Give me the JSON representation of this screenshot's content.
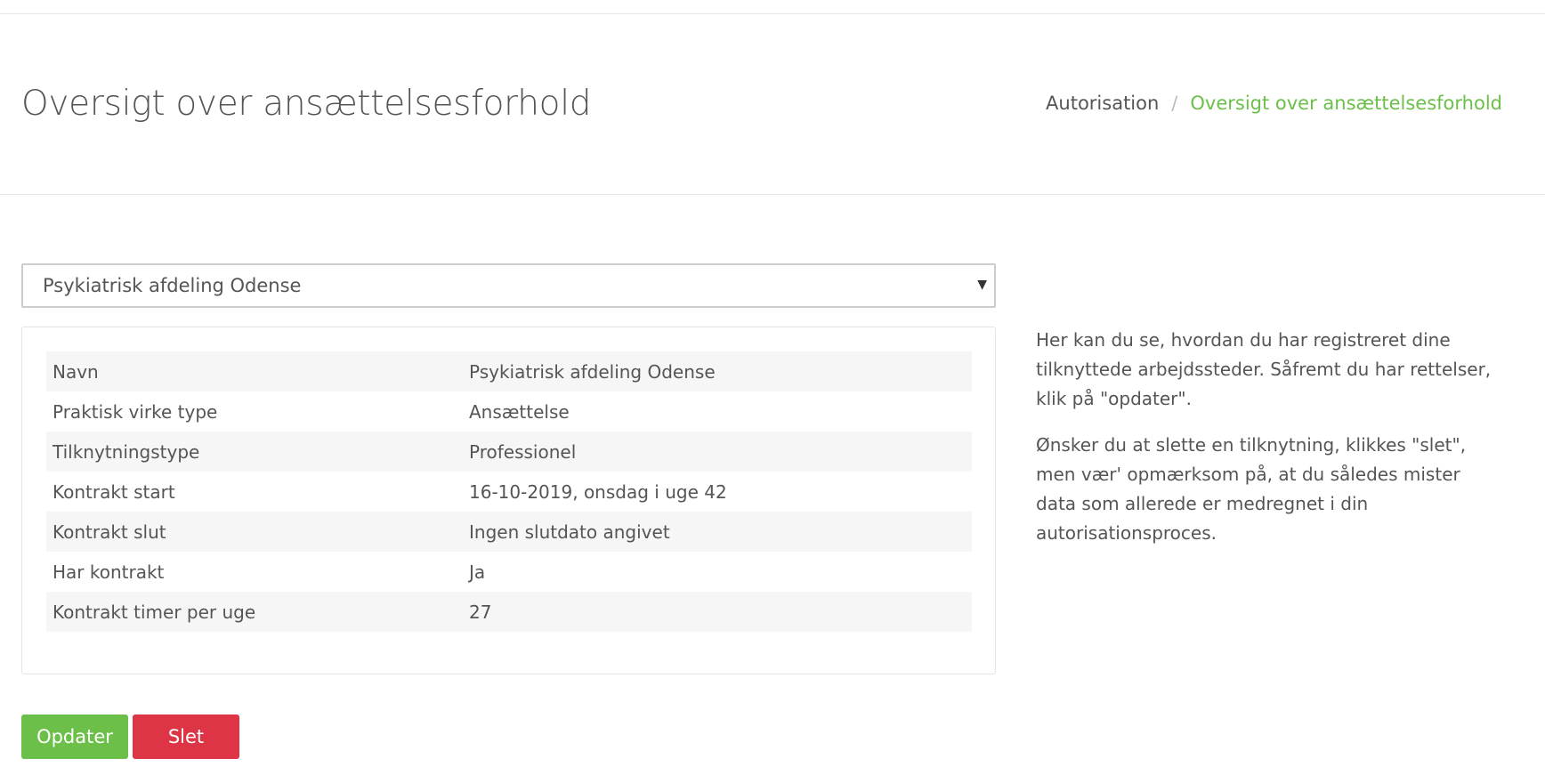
{
  "header": {
    "title": "Oversigt over ansættelsesforhold",
    "breadcrumb": {
      "parent": "Autorisation",
      "separator": "/",
      "current": "Oversigt over ansættelsesforhold"
    }
  },
  "workplace_select": {
    "selected": "Psykiatrisk afdeling Odense"
  },
  "details": [
    {
      "label": "Navn",
      "value": "Psykiatrisk afdeling Odense"
    },
    {
      "label": "Praktisk virke type",
      "value": "Ansættelse"
    },
    {
      "label": "Tilknytningstype",
      "value": "Professionel"
    },
    {
      "label": "Kontrakt start",
      "value": "16-10-2019, onsdag i uge 42"
    },
    {
      "label": "Kontrakt slut",
      "value": "Ingen slutdato angivet"
    },
    {
      "label": "Har kontrakt",
      "value": "Ja"
    },
    {
      "label": "Kontrakt timer per uge",
      "value": "27"
    }
  ],
  "help": {
    "paragraph1": "Her kan du se, hvordan du har registreret dine tilknyttede arbejdssteder. Såfremt du har rettelser, klik på \"opdater\".",
    "paragraph2": "Ønsker du at slette en tilknytning, klikkes \"slet\", men vær' opmærksom på, at du således mister data som allerede er medregnet i din autorisationsproces."
  },
  "actions": {
    "update_label": "Opdater",
    "delete_label": "Slet"
  },
  "colors": {
    "accent": "#6cc04a",
    "danger": "#dd3545"
  }
}
